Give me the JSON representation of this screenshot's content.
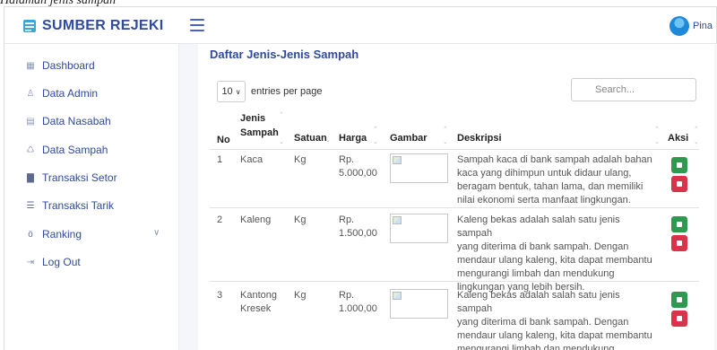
{
  "caption": "Halaman jenis sampah",
  "brand": {
    "name": "SUMBER REJEKI"
  },
  "user": {
    "name": "Pina"
  },
  "sidebar": {
    "items": [
      {
        "label": "Dashboard",
        "icon": "dashboard-icon"
      },
      {
        "label": "Data Admin",
        "icon": "user-icon"
      },
      {
        "label": "Data Nasabah",
        "icon": "users-icon"
      },
      {
        "label": "Data Sampah",
        "icon": "recycle-icon"
      },
      {
        "label": "Transaksi Setor",
        "icon": "deposit-icon"
      },
      {
        "label": "Transaksi Tarik",
        "icon": "withdraw-icon"
      },
      {
        "label": "Ranking",
        "icon": "medal-icon"
      },
      {
        "label": "Log Out",
        "icon": "logout-icon"
      }
    ]
  },
  "main": {
    "title": "Daftar Jenis-Jenis Sampah",
    "entries": {
      "value": "10",
      "label": "entries per page"
    },
    "search": {
      "placeholder": "Search..."
    },
    "table": {
      "headers": {
        "no": "No",
        "jenis_line1": "Jenis",
        "jenis_line2": "Sampah",
        "satuan": "Satuan",
        "harga": "Harga",
        "gambar": "Gambar",
        "deskripsi": "Deskripsi",
        "aksi": "Aksi"
      },
      "rows": [
        {
          "no": "1",
          "jenis_line1": "Kaca",
          "jenis_line2": "",
          "satuan": "Kg",
          "harga_line1": "Rp.",
          "harga_line2": "5.000,00",
          "desc": [
            "Sampah kaca di bank sampah adalah bahan",
            "kaca yang dihimpun untuk didaur ulang,",
            "beragam bentuk, tahan lama, dan memiliki",
            "nilai ekonomi serta manfaat lingkungan."
          ]
        },
        {
          "no": "2",
          "jenis_line1": "Kaleng",
          "jenis_line2": "",
          "satuan": "Kg",
          "harga_line1": "Rp.",
          "harga_line2": "1.500,00",
          "desc": [
            "Kaleng bekas adalah salah satu jenis sampah",
            "yang diterima di bank sampah. Dengan",
            "mendaur ulang kaleng, kita dapat membantu",
            "mengurangi limbah dan mendukung",
            "lingkungan yang lebih bersih."
          ]
        },
        {
          "no": "3",
          "jenis_line1": "Kantong",
          "jenis_line2": "Kresek",
          "satuan": "Kg",
          "harga_line1": "Rp.",
          "harga_line2": "1.000,00",
          "desc": [
            "Kaleng bekas adalah salah satu jenis sampah",
            "yang diterima di bank sampah. Dengan",
            "mendaur ulang kaleng, kita dapat membantu",
            "mengurangi limbah dan mendukung"
          ]
        }
      ]
    }
  },
  "colors": {
    "brand": "#2f4a9e",
    "edit": "#2e9a4f",
    "delete": "#d8334a"
  }
}
